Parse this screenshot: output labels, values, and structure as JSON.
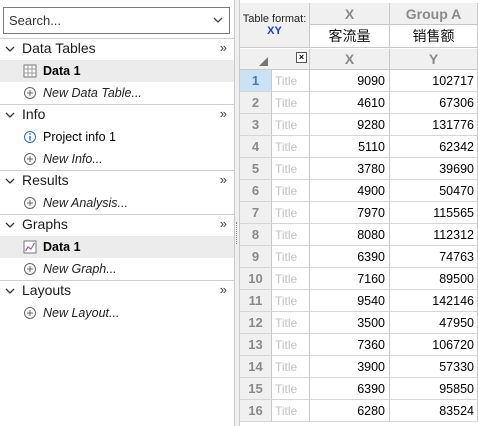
{
  "search": {
    "placeholder": "Search..."
  },
  "sections": [
    {
      "label": "Data Tables",
      "more": "»",
      "items": [
        {
          "label": "Data 1",
          "icon": "data-table-icon",
          "selected": true
        },
        {
          "label": "New Data Table...",
          "icon": "add-circle-icon",
          "new": true
        }
      ]
    },
    {
      "label": "Info",
      "more": "»",
      "items": [
        {
          "label": "Project info 1",
          "icon": "info-icon"
        },
        {
          "label": "New Info...",
          "icon": "add-circle-icon",
          "new": true
        }
      ]
    },
    {
      "label": "Results",
      "more": "»",
      "items": [
        {
          "label": "New Analysis...",
          "icon": "add-circle-icon",
          "new": true
        }
      ]
    },
    {
      "label": "Graphs",
      "more": "»",
      "items": [
        {
          "label": "Data 1",
          "icon": "graph-icon",
          "selected": true
        },
        {
          "label": "New Graph...",
          "icon": "add-circle-icon",
          "new": true
        }
      ]
    },
    {
      "label": "Layouts",
      "more": "»",
      "items": [
        {
          "label": "New Layout...",
          "icon": "add-circle-icon",
          "new": true
        }
      ]
    }
  ],
  "sheet": {
    "table_format_label": "Table format:",
    "table_format_value": "XY",
    "columns": [
      {
        "title": "X",
        "name": "客流量",
        "sub": "X"
      },
      {
        "title": "Group A",
        "name": "销售额",
        "sub": "Y"
      }
    ],
    "row_title_placeholder": "Title",
    "active_row": 1,
    "rows": [
      {
        "n": "1",
        "x": "9090",
        "y": "102717"
      },
      {
        "n": "2",
        "x": "4610",
        "y": "67306"
      },
      {
        "n": "3",
        "x": "9280",
        "y": "131776"
      },
      {
        "n": "4",
        "x": "5110",
        "y": "62342"
      },
      {
        "n": "5",
        "x": "3780",
        "y": "39690"
      },
      {
        "n": "6",
        "x": "4900",
        "y": "50470"
      },
      {
        "n": "7",
        "x": "7970",
        "y": "115565"
      },
      {
        "n": "8",
        "x": "8080",
        "y": "112312"
      },
      {
        "n": "9",
        "x": "6390",
        "y": "74763"
      },
      {
        "n": "10",
        "x": "7160",
        "y": "89500"
      },
      {
        "n": "11",
        "x": "9540",
        "y": "142146"
      },
      {
        "n": "12",
        "x": "3500",
        "y": "47950"
      },
      {
        "n": "13",
        "x": "7360",
        "y": "106720"
      },
      {
        "n": "14",
        "x": "3900",
        "y": "57330"
      },
      {
        "n": "15",
        "x": "6390",
        "y": "95850"
      },
      {
        "n": "16",
        "x": "6280",
        "y": "83524"
      }
    ]
  }
}
